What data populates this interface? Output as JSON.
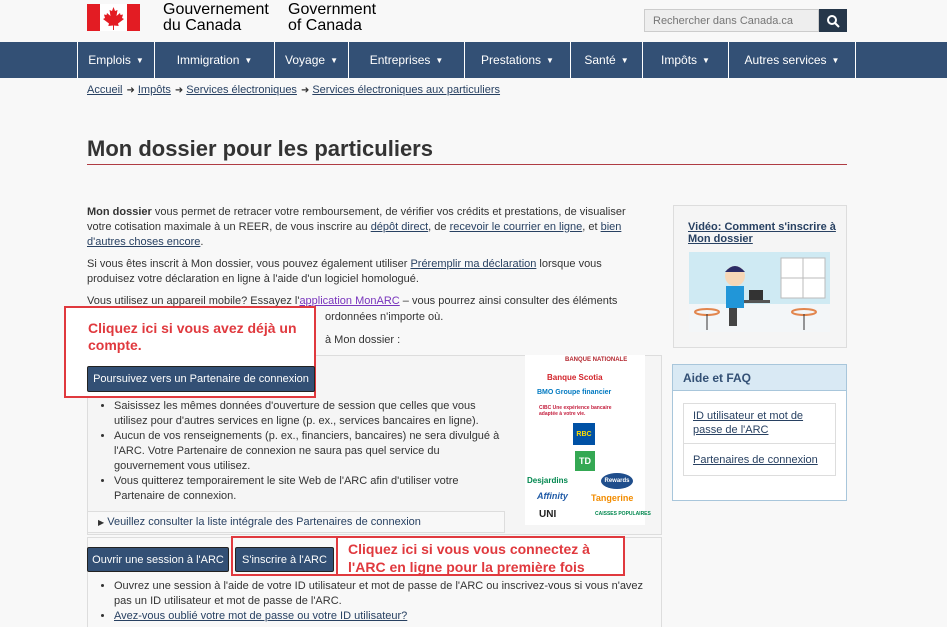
{
  "header": {
    "signature_fr": [
      "Gouvernement",
      "du Canada"
    ],
    "signature_en": [
      "Government",
      "of Canada"
    ],
    "search_placeholder": "Rechercher dans Canada.ca",
    "colors": {
      "flag_red": "#e31c23",
      "menu_bg": "#335075",
      "search_button": "#26374a"
    }
  },
  "menu": {
    "items": [
      "Emplois",
      "Immigration",
      "Voyage",
      "Entreprises",
      "Prestations",
      "Santé",
      "Impôts",
      "Autres services"
    ]
  },
  "breadcrumb": [
    "Accueil",
    "Impôts",
    "Services électroniques",
    "Services électroniques aux particuliers"
  ],
  "page_title": "Mon dossier pour les particuliers",
  "intro": {
    "bold_lead": "Mon dossier",
    "text1": " vous permet de retracer votre remboursement, de vérifier vos crédits et prestations, de visualiser votre cotisation maximale à un REER, de vous inscrire au ",
    "link_depot": "dépôt direct",
    "text2": ", de ",
    "link_courrier": "recevoir le courrier en ligne",
    "text3": ", et ",
    "link_autres": "bien d'autres choses encore",
    "text4": "."
  },
  "para2": {
    "text1": "Si vous êtes inscrit à Mon dossier, vous pouvez également utiliser ",
    "link": "Préremplir ma déclaration",
    "text2": " lorsque vous produisez votre déclaration en ligne à l'aide d'un logiciel homologué."
  },
  "para3": {
    "text1": "Vous utilisez un appareil mobile? Essayez l'",
    "link": "application MonARC",
    "text2": " – vous pourrez ainsi consulter des éléments essentiels",
    "line2_tail": "ordonnées n'importe où.",
    "line3_tail": "à Mon dossier :"
  },
  "callout_top": "Cliquez ici si vous avez déjà un compte.",
  "partner_button": "Poursuivez vers un Partenaire de connexion",
  "partner_bullets": [
    "Saisissez les mêmes données d'ouverture de session que celles que vous utilisez pour d'autres services en ligne (p. ex., services bancaires en ligne).",
    "Aucun de vos renseignements (p. ex., financiers, bancaires) ne sera divulgué à l'ARC. Votre Partenaire de connexion ne saura pas quel service du gouvernement vous utilisez.",
    "Vous quitterez temporairement le site Web de l'ARC afin d'utiliser votre Partenaire de connexion."
  ],
  "partners_details": "Veuillez consulter la liste intégrale des Partenaires de connexion",
  "bank_logos": [
    "BANQUE NATIONALE",
    "Banque Scotia",
    "BMO Groupe financier",
    "CIBC Une expérience bancaire adaptée à votre vie.",
    "RBC",
    "TD",
    "Desjardins",
    "Rewards",
    "Affinity",
    "Tangerine",
    "UNI",
    "CAISSES POPULAIRES"
  ],
  "login_button": "Ouvrir une session à l'ARC",
  "register_button": "S'inscrire à l'ARC",
  "callout_bottom": "Cliquez ici si vous vous connectez à l'ARC en ligne pour la première fois",
  "cra_bullets": {
    "item1": "Ouvrez une session à l'aide de votre ID utilisateur et mot de passe de l'ARC ou inscrivez-vous si vous n'avez pas un ID utilisateur et mot de passe de l'ARC.",
    "item2_link": "Avez-vous oublié votre mot de passe ou votre ID utilisateur?"
  },
  "sidebar": {
    "video_title": "Vidéo: Comment s'inscrire à Mon dossier",
    "faq_title": "Aide et FAQ",
    "faq_links": [
      "ID utilisateur et mot de passe de l'ARC",
      "Partenaires de connexion"
    ]
  }
}
